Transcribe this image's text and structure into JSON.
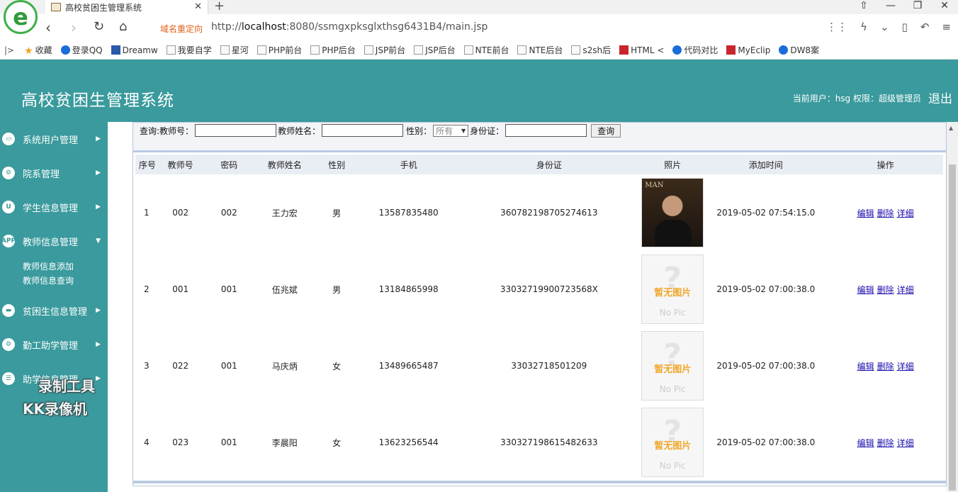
{
  "browser": {
    "tab_title": "高校贫困生管理系统",
    "redirect_label": "域名重定向",
    "url_prefix": "http://",
    "url_host": "localhost",
    "url_rest": ":8080/ssmgxpksglxthsg6431B4/main.jsp",
    "bookmarks": [
      "收藏",
      "登录QQ",
      "Dreamw",
      "我要自学",
      "星河",
      "PHP前台",
      "PHP后台",
      "JSP前台",
      "JSP后台",
      "NTE前台",
      "NTE后台",
      "s2sh后",
      "HTML <",
      "代码对比",
      "MyEclip",
      "DW8案"
    ]
  },
  "header": {
    "title": "高校贫困生管理系统",
    "user_info": "当前用户：hsg 权限：超级管理员",
    "logout": "退出"
  },
  "sidebar": {
    "items": [
      {
        "label": "系统用户管理"
      },
      {
        "label": "院系管理"
      },
      {
        "label": "学生信息管理"
      },
      {
        "label": "教师信息管理"
      },
      {
        "label": "贫困生信息管理"
      },
      {
        "label": "勤工助学管理"
      },
      {
        "label": "助学信息管理"
      }
    ],
    "submenu": [
      "教师信息添加",
      "教师信息查询"
    ],
    "watermark_line1": "录制工具",
    "watermark_line2": "KK录像机"
  },
  "search": {
    "label_query": "查询:",
    "label_teacher_no": "教师号：",
    "label_teacher_name": "教师姓名：",
    "label_gender": "性别：",
    "gender_value": "所有",
    "label_id": "身份证：",
    "button": "查询"
  },
  "table": {
    "headers": [
      "序号",
      "教师号",
      "密码",
      "教师姓名",
      "性别",
      "手机",
      "身份证",
      "照片",
      "添加时间",
      "操作"
    ],
    "actions": [
      "编辑",
      "删除",
      "详细"
    ],
    "nopic_zh": "暂无图片",
    "nopic_en": "No Pic",
    "photo_caption": "MAN",
    "rows": [
      {
        "no": "1",
        "teacher_no": "002",
        "password": "002",
        "name": "王力宏",
        "gender": "男",
        "phone": "13587835480",
        "id_card": "360782198705274613",
        "photo": "person",
        "time": "2019-05-02 07:54:15.0"
      },
      {
        "no": "2",
        "teacher_no": "001",
        "password": "001",
        "name": "伍兆斌",
        "gender": "男",
        "phone": "13184865998",
        "id_card": "33032719900723568X",
        "photo": "nopic",
        "time": "2019-05-02 07:00:38.0"
      },
      {
        "no": "3",
        "teacher_no": "022",
        "password": "001",
        "name": "马庆炳",
        "gender": "女",
        "phone": "13489665487",
        "id_card": "33032718501209",
        "photo": "nopic",
        "time": "2019-05-02 07:00:38.0"
      },
      {
        "no": "4",
        "teacher_no": "023",
        "password": "001",
        "name": "李晨阳",
        "gender": "女",
        "phone": "13623256544",
        "id_card": "330327198615482633",
        "photo": "nopic",
        "time": "2019-05-02 07:00:38.0"
      }
    ]
  }
}
